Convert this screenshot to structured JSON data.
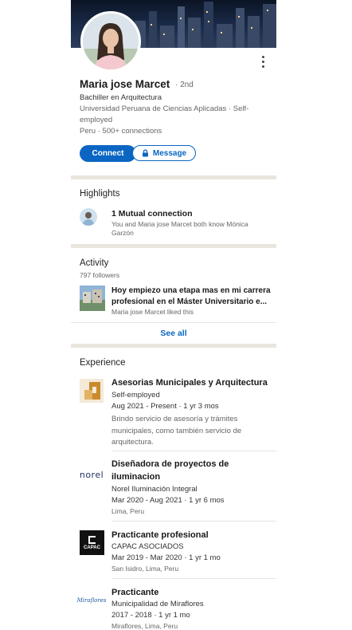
{
  "profile": {
    "name": "Maria jose Marcet",
    "degree": "· 2nd",
    "headline": "Bachiller en Arquitectura",
    "education": "Universidad Peruana de Ciencias Aplicadas · Self-employed",
    "location": "Peru",
    "connections": "500+ connections",
    "connect_label": "Connect",
    "message_label": "Message"
  },
  "highlights": {
    "title": "Highlights",
    "mutual_title": "1 Mutual connection",
    "mutual_desc": "You and Maria jose Marcet both know Mónica Garzón"
  },
  "activity": {
    "title": "Activity",
    "followers": "797 followers",
    "post_text": "Hoy empiezo una etapa mas en mi carrera profesional en el Máster Universitario e...",
    "post_meta": "Maria jose Marcet liked this",
    "see_all": "See all"
  },
  "experience": {
    "title": "Experience",
    "items": [
      {
        "title": "Asesorias Municipales y Arquitectura",
        "company": "Self-employed",
        "dates": "Aug 2021 - Present  ·  1 yr 3 mos",
        "description": "Brindo servicio de asesoría y trámites municipales, como también servicio de arquitectura."
      },
      {
        "title": "Diseñadora de proyectos de iluminacion",
        "company": "Norel Iluminación Integral",
        "dates": "Mar 2020 - Aug 2021  ·  1 yr 6 mos",
        "location": "Lima, Peru",
        "logo_text": "norel"
      },
      {
        "title": "Practicante profesional",
        "company": "CAPAC ASOCIADOS",
        "dates": "Mar 2019 - Mar 2020  ·  1 yr 1 mo",
        "location": "San Isidro, Lima, Peru",
        "logo_text": "CAPAC"
      },
      {
        "title": "Practicante",
        "company": "Municipalidad de Miraflores",
        "dates": "2017 - 2018  ·  1 yr 1 mo",
        "location": "Miraflores, Lima, Peru",
        "logo_text": "Miraflores"
      }
    ]
  },
  "colors": {
    "brand": "#0a66c2",
    "separator": "#e9e5df"
  }
}
